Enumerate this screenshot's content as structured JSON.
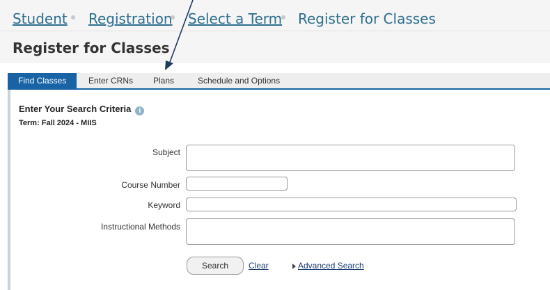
{
  "breadcrumb": {
    "items": [
      {
        "label": "Student"
      },
      {
        "label": "Registration"
      },
      {
        "label": "Select a Term"
      },
      {
        "label": "Register for Classes"
      }
    ]
  },
  "page": {
    "title": "Register for Classes"
  },
  "tabs": [
    {
      "label": "Find Classes",
      "active": true
    },
    {
      "label": "Enter CRNs",
      "active": false
    },
    {
      "label": "Plans",
      "active": false
    },
    {
      "label": "Schedule and Options",
      "active": false
    }
  ],
  "search": {
    "heading": "Enter Your Search Criteria",
    "info_icon": "i",
    "term": "Term: Fall 2024 - MIIS",
    "fields": {
      "subject": {
        "label": "Subject",
        "value": ""
      },
      "course_number": {
        "label": "Course Number",
        "value": ""
      },
      "keyword": {
        "label": "Keyword",
        "value": ""
      },
      "instructional_methods": {
        "label": "Instructional Methods",
        "value": ""
      }
    },
    "search_button": "Search",
    "clear_link": "Clear",
    "advanced_link": "Advanced Search"
  },
  "colors": {
    "tab_active": "#1763a5",
    "link": "#2d6e8f",
    "annotation_arrow": "#1f3a5f"
  },
  "icons": {
    "info": "info-icon",
    "expand": "caret-right-icon",
    "annotation": "arrow-pointer-annotation"
  }
}
